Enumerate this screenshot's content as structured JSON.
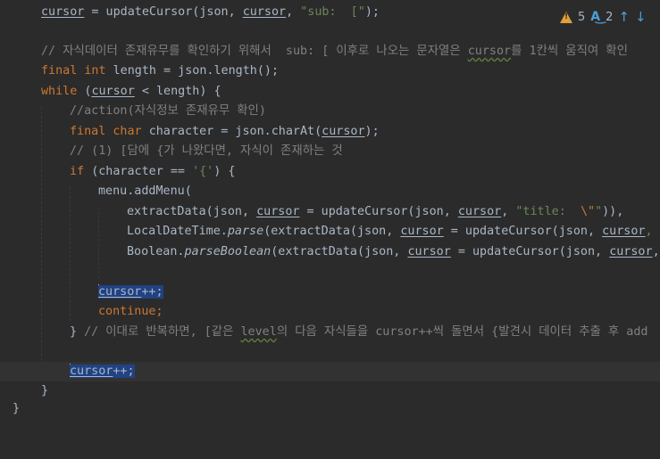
{
  "inspection": {
    "warnings": "5",
    "typos": "2",
    "warning_icon": "warning-triangle-icon",
    "typo_icon": "typo-icon",
    "up_icon": "arrow-up-icon",
    "down_icon": "arrow-down-icon"
  },
  "colors": {
    "background": "#2b2b2b",
    "keyword": "#cc7832",
    "string": "#6a8759",
    "comment": "#808080",
    "text": "#a9b7c6",
    "selection": "#214283",
    "warning": "#e0a038",
    "typo": "#4e9ed8"
  },
  "code": {
    "l1_var": "cursor",
    "l1_rest": " = updateCursor(json, ",
    "l1_var2": "cursor",
    "l1_comma": ", ",
    "l1_str": "\"sub:  [\"",
    "l1_end": ");",
    "l3_comment_a": "// 자식데이터 존재유무를 확인하기 위해서  sub: [ 이후로 나오는 문자열은 ",
    "l3_comment_b": "cursor",
    "l3_comment_c": "를 1칸씩 움직여 확인",
    "l4_kw1": "final ",
    "l4_kw2": "int ",
    "l4_rest": "length = json.length();",
    "l5_kw": "while ",
    "l5_open": "(",
    "l5_var": "cursor",
    "l5_rest": " < length) {",
    "l6_comment": "//action(자식정보 존재유무 확인)",
    "l7_kw1": "final ",
    "l7_kw2": "char ",
    "l7_rest": "character = json.charAt(",
    "l7_var": "cursor",
    "l7_end": ");",
    "l8_comment": "// (1) [담에 {가 나왔다면, 자식이 존재하는 것",
    "l9_kw": "if ",
    "l9_rest": "(character == ",
    "l9_char": "'{'",
    "l9_end": ") {",
    "l10_text": "menu.addMenu(",
    "l11_a": "extractData(json, ",
    "l11_var": "cursor",
    "l11_b": " = updateCursor(json, ",
    "l11_var2": "cursor",
    "l11_c": ", ",
    "l11_str": "\"title:  ",
    "l11_esc": "\\\"",
    "l11_str_end": "\"",
    "l11_end": ")),",
    "l12_a": "LocalDateTime.",
    "l12_fn": "parse",
    "l12_b": "(extractData(json, ",
    "l12_var": "cursor",
    "l12_c": " = updateCursor(json, ",
    "l12_var2": "cursor",
    "l12_d": ", \"",
    "l13_a": "Boolean.",
    "l13_fn": "parseBoolean",
    "l13_b": "(extractData(json, ",
    "l13_var": "cursor",
    "l13_c": " = updateCursor(json, ",
    "l13_var2": "cursor",
    "l13_d": ",",
    "l15_var": "cursor",
    "l15_rest": "++;",
    "l16_kw": "continue;",
    "l17_brace": "} ",
    "l17_comment_a": "// 이대로 반복하면, [같은 ",
    "l17_comment_b": "level",
    "l17_comment_c": "의 다음 자식들을 cursor++씩 돌면서 {발견시 데이터 추출 후 add",
    "l19_var": "cursor",
    "l19_rest": "++;",
    "l20_brace": "}",
    "l21_brace": "}"
  }
}
